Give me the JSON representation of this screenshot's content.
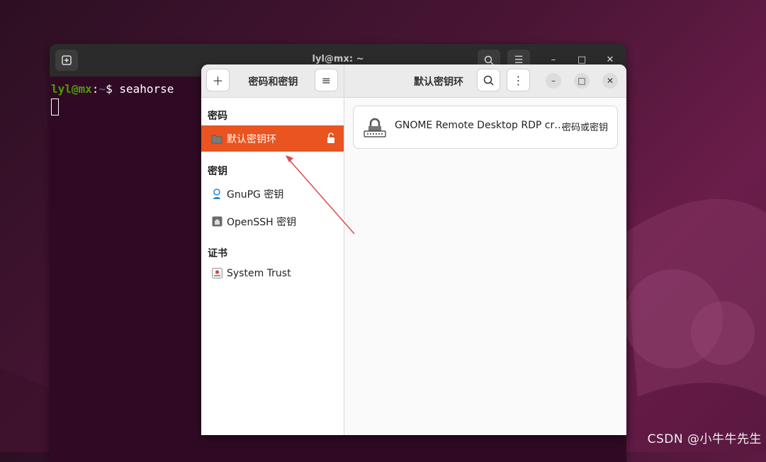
{
  "terminal": {
    "title": "lyl@mx: ~",
    "prompt_user": "lyl@mx",
    "prompt_sep": ":",
    "prompt_path": "~",
    "prompt_symbol": "$",
    "command": "seahorse"
  },
  "seahorse": {
    "sidebar_title": "密码和密钥",
    "main_title": "默认密钥环",
    "sections": [
      {
        "heading": "密码",
        "items": [
          {
            "label": "默认密钥环",
            "icon": "folder-icon",
            "selected": true
          }
        ]
      },
      {
        "heading": "密钥",
        "items": [
          {
            "label": "GnuPG 密钥",
            "icon": "gnupg-key-icon"
          },
          {
            "label": "OpenSSH 密钥",
            "icon": "ssh-key-icon"
          }
        ]
      },
      {
        "heading": "证书",
        "items": [
          {
            "label": "System Trust",
            "icon": "certificate-icon"
          }
        ]
      }
    ],
    "entries": [
      {
        "name": "GNOME Remote Desktop RDP cr…",
        "type": "密码或密钥",
        "icon": "password-lock-icon"
      }
    ]
  },
  "watermark": "CSDN @小牛牛先生",
  "colors": {
    "accent": "#e95420",
    "terminal_bg": "#300a24"
  }
}
